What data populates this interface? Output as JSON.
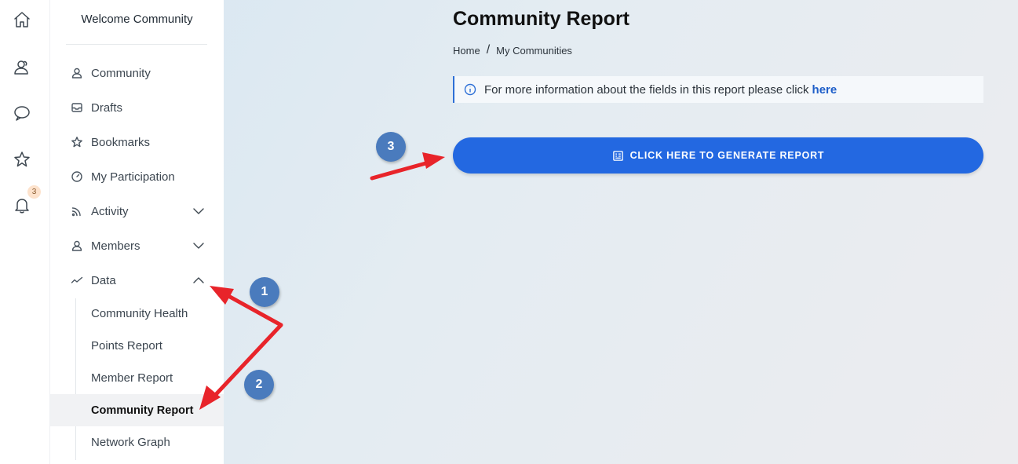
{
  "rail": {
    "icons": [
      "home-icon",
      "community-icon",
      "chat-icon",
      "star-icon",
      "bell-icon"
    ],
    "notification_count": "3"
  },
  "sidebar": {
    "title": "Welcome Community",
    "items": [
      {
        "label": "Community",
        "icon": "community-icon"
      },
      {
        "label": "Drafts",
        "icon": "inbox-icon"
      },
      {
        "label": "Bookmarks",
        "icon": "star-icon"
      },
      {
        "label": "My Participation",
        "icon": "gauge-icon"
      },
      {
        "label": "Activity",
        "icon": "rss-icon",
        "expandable": true,
        "expanded": false
      },
      {
        "label": "Members",
        "icon": "person-icon",
        "expandable": true,
        "expanded": false
      },
      {
        "label": "Data",
        "icon": "trend-icon",
        "expandable": true,
        "expanded": true
      }
    ],
    "data_subitems": [
      {
        "label": "Community Health"
      },
      {
        "label": "Points Report"
      },
      {
        "label": "Member Report"
      },
      {
        "label": "Community Report",
        "active": true
      },
      {
        "label": "Network Graph"
      }
    ]
  },
  "main": {
    "title": "Community Report",
    "breadcrumb": [
      "Home",
      "My Communities"
    ],
    "breadcrumb_separator": "/",
    "info_text": "For more information about the fields in this report please click",
    "info_link": "here",
    "generate_button": "CLICK HERE TO GENERATE REPORT"
  },
  "annotations": {
    "steps": [
      "1",
      "2",
      "3"
    ],
    "arrow_color": "#e8242a",
    "badge_color": "#4a7bbd"
  },
  "colors": {
    "accent": "#2368e1",
    "link": "#1f5fc9"
  }
}
